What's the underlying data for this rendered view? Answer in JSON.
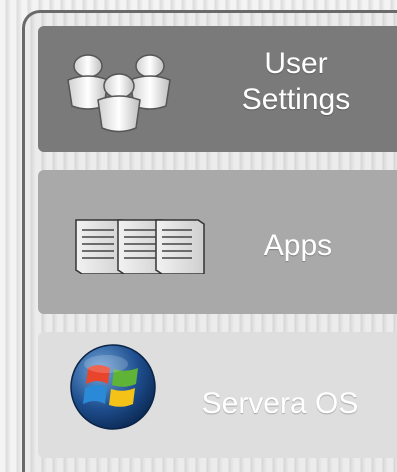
{
  "layers": {
    "user_settings": {
      "line1": "User",
      "line2": "Settings",
      "icon": "users-icon",
      "color": "#7a7a7a"
    },
    "apps": {
      "label": "Apps",
      "icon": "documents-icon",
      "color": "#a9a9a9"
    },
    "os": {
      "label": "Servera OS",
      "icon": "windows-logo-icon",
      "color": "#dedede"
    }
  }
}
